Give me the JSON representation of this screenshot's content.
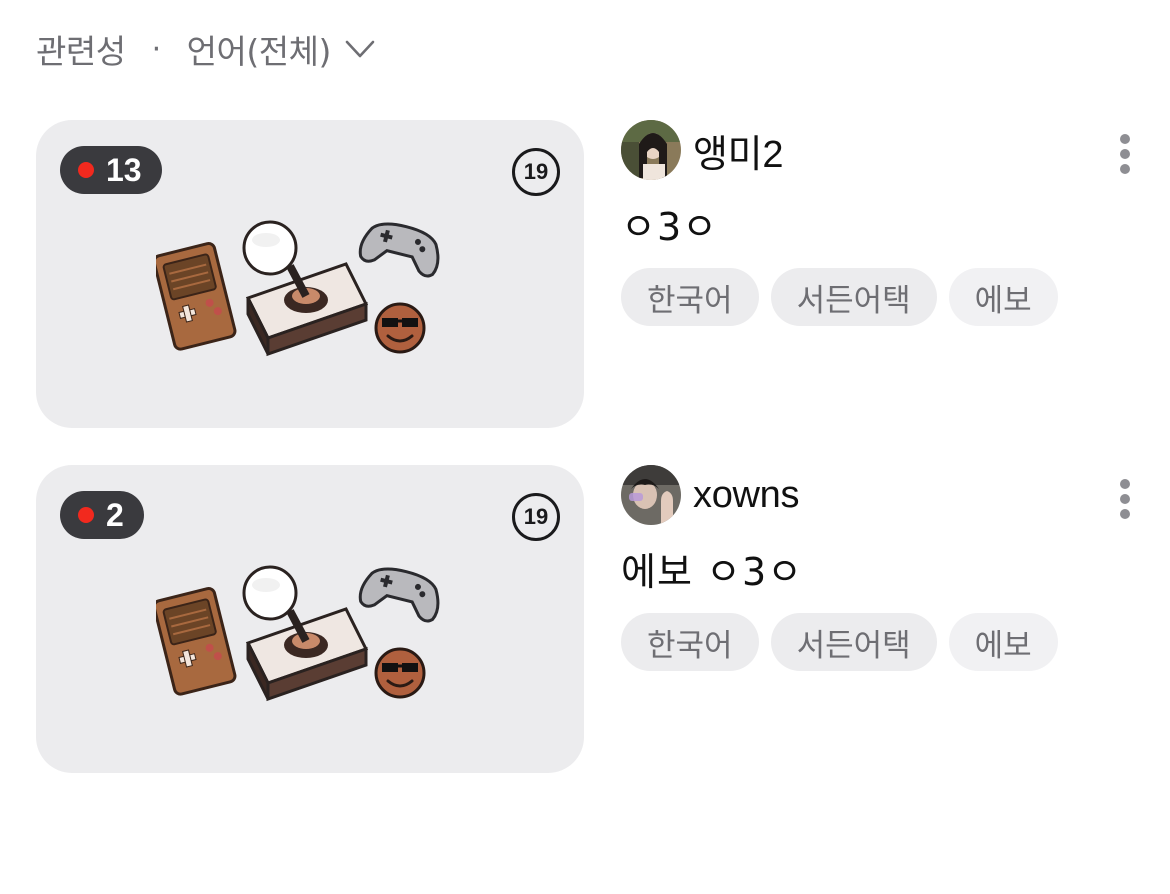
{
  "filter_bar": {
    "sort_label": "관련성",
    "separator": "·",
    "language_label": "언어(전체)"
  },
  "streams": [
    {
      "viewer_count": "13",
      "age_rating": "19",
      "streamer_name": "앵미2",
      "title": "ㅇ3ㅇ",
      "tags": [
        "한국어",
        "서든어택",
        "에보"
      ]
    },
    {
      "viewer_count": "2",
      "age_rating": "19",
      "streamer_name": "xowns",
      "title": "에보 ㅇ3ㅇ",
      "tags": [
        "한국어",
        "서든어택",
        "에보"
      ]
    }
  ],
  "colors": {
    "live_dot": "#f2291e",
    "thumb_bg": "#ececee",
    "badge_bg": "#3a3a3e",
    "tag_text": "#6e6e73"
  },
  "icons": {
    "chevron": "chevron-down-icon",
    "more": "more-vertical-icon",
    "thumbnail_art": "game-console-illustration"
  }
}
